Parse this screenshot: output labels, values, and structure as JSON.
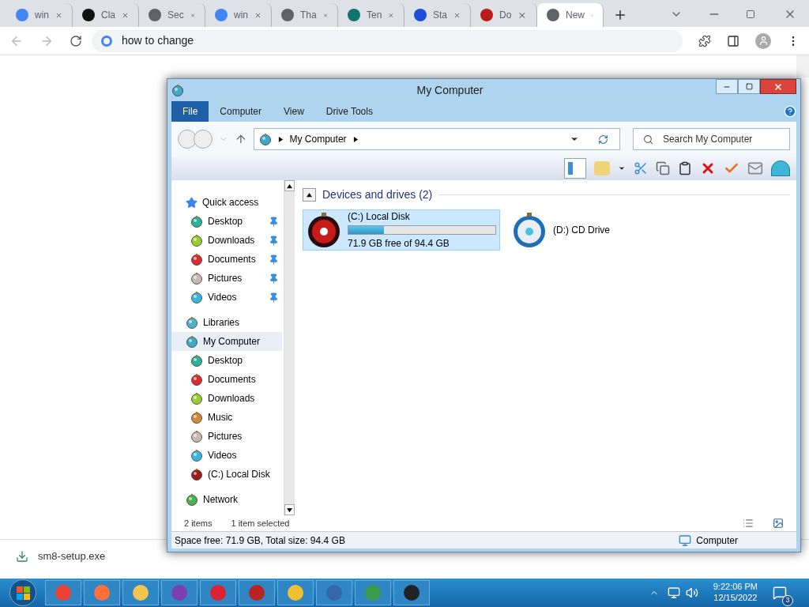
{
  "browser": {
    "tabs": [
      {
        "label": "win",
        "selected": false,
        "color": "#4285f4"
      },
      {
        "label": "Cla",
        "selected": false,
        "color": "#111111"
      },
      {
        "label": "Sec",
        "selected": false,
        "color": "#5f6368"
      },
      {
        "label": "win",
        "selected": false,
        "color": "#4285f4"
      },
      {
        "label": "Tha",
        "selected": false,
        "color": "#5f6368"
      },
      {
        "label": "Ten",
        "selected": false,
        "color": "#0f766e"
      },
      {
        "label": "Sta",
        "selected": false,
        "color": "#1d4ed8"
      },
      {
        "label": "Do",
        "selected": false,
        "color": "#b91c1c"
      },
      {
        "label": "New",
        "selected": true,
        "color": "#5f6368"
      }
    ],
    "address": "how to change"
  },
  "explorer": {
    "title": "My Computer",
    "ribbon_tabs": [
      {
        "label": "File",
        "selected": true
      },
      {
        "label": "Computer",
        "selected": false
      },
      {
        "label": "View",
        "selected": false
      },
      {
        "label": "Drive Tools",
        "selected": false
      }
    ],
    "breadcrumb": "My Computer",
    "search": {
      "placeholder": "Search My Computer"
    },
    "nav": [
      {
        "label": "Quick access",
        "selected": false,
        "color": "#3b82f6",
        "children": [
          {
            "label": "Desktop",
            "selected": false,
            "color": "#2bb39a",
            "pinned": true
          },
          {
            "label": "Downloads",
            "selected": false,
            "color": "#9acd32",
            "pinned": true
          },
          {
            "label": "Documents",
            "selected": false,
            "color": "#d62f2f",
            "pinned": true
          },
          {
            "label": "Pictures",
            "selected": false,
            "color": "#c9b8b8",
            "pinned": true
          },
          {
            "label": "Videos",
            "selected": false,
            "color": "#38b6e0",
            "pinned": true
          }
        ]
      },
      {
        "label": "Libraries",
        "selected": false,
        "color": "#4fb3c8"
      },
      {
        "label": "My Computer",
        "selected": true,
        "color": "#3fa9c9",
        "children": [
          {
            "label": "Desktop",
            "selected": false,
            "color": "#2bb39a",
            "pinned": false
          },
          {
            "label": "Documents",
            "selected": false,
            "color": "#d62f2f",
            "pinned": false
          },
          {
            "label": "Downloads",
            "selected": false,
            "color": "#9acd32",
            "pinned": false
          },
          {
            "label": "Music",
            "selected": false,
            "color": "#d08a3a",
            "pinned": false
          },
          {
            "label": "Pictures",
            "selected": false,
            "color": "#c9b8b8",
            "pinned": false
          },
          {
            "label": "Videos",
            "selected": false,
            "color": "#38b6e0",
            "pinned": false
          },
          {
            "label": "(C:) Local Disk",
            "selected": false,
            "color": "#9b1c1c",
            "pinned": false
          }
        ]
      },
      {
        "label": "Network",
        "selected": false,
        "color": "#4caf50"
      }
    ],
    "group": {
      "title": "Devices and drives (2)",
      "expanded": true
    },
    "drives": [
      {
        "kind": "disk",
        "name": "(C:) Local Disk",
        "selected": true,
        "level": 0.24,
        "free": "71.9 GB free of 94.4 GB"
      },
      {
        "kind": "cd",
        "name": "(D:) CD Drive",
        "selected": false
      }
    ],
    "status": {
      "count": "2 items",
      "selection": "1 item selected"
    },
    "details": {
      "text": "Space free: 71.9 GB, Total size: 94.4 GB",
      "location": "Computer"
    }
  },
  "download": {
    "file": "sm8-setup.exe"
  },
  "taskbar": {
    "time": "9:22:06 PM",
    "date": "12/15/2022",
    "notifications": "3"
  }
}
